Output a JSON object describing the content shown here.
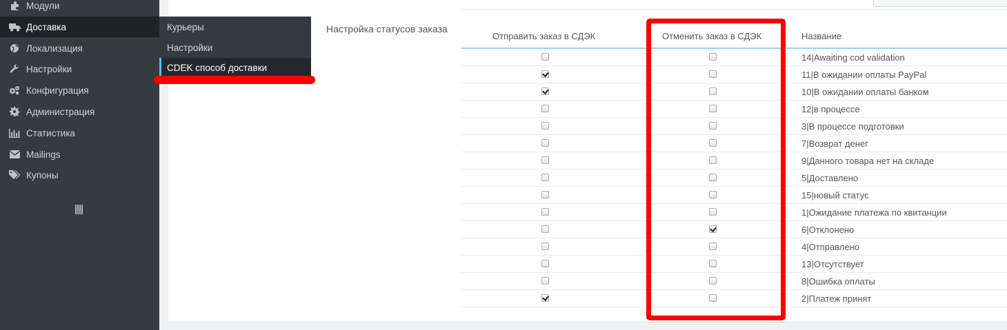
{
  "sidebar": {
    "items": [
      {
        "label": "Модули",
        "icon": "puzzle-icon"
      },
      {
        "label": "Доставка",
        "icon": "truck-icon",
        "active": true
      },
      {
        "label": "Локализация",
        "icon": "globe-icon"
      },
      {
        "label": "Настройки",
        "icon": "wrench-icon"
      },
      {
        "label": "Конфигурация",
        "icon": "cogs-icon"
      },
      {
        "label": "Администрация",
        "icon": "gear-icon"
      },
      {
        "label": "Статистика",
        "icon": "bar-chart-icon"
      },
      {
        "label": "Mailings",
        "icon": "envelope-icon"
      },
      {
        "label": "Купоны",
        "icon": "tags-icon"
      }
    ],
    "collapse_icon": "collapse-bars-icon"
  },
  "submenu": {
    "items": [
      {
        "label": "Курьеры"
      },
      {
        "label": "Настройки"
      },
      {
        "label": "CDEK способ доставки",
        "selected": true
      }
    ]
  },
  "form": {
    "section_label": "Настройка статусов заказа",
    "columns": {
      "send": "Отправить заказ в СДЭК",
      "cancel": "Отменить заказ в СДЭК",
      "name": "Название"
    },
    "rows": [
      {
        "name": "14|Awaiting cod validation",
        "send": false,
        "cancel": false
      },
      {
        "name": "11|В ожидании оплаты PayPal",
        "send": true,
        "cancel": false
      },
      {
        "name": "10|В ожидании оплаты банком",
        "send": true,
        "cancel": false
      },
      {
        "name": "12|в процессе",
        "send": false,
        "cancel": false
      },
      {
        "name": "3|В процессе подготовки",
        "send": false,
        "cancel": false
      },
      {
        "name": "7|Возврат денег",
        "send": false,
        "cancel": false
      },
      {
        "name": "9|Данного товара нет на складе",
        "send": false,
        "cancel": false
      },
      {
        "name": "5|Доставлено",
        "send": false,
        "cancel": false
      },
      {
        "name": "15|новый статус",
        "send": false,
        "cancel": false
      },
      {
        "name": "1|Ожидание платежа по квитанции",
        "send": false,
        "cancel": false
      },
      {
        "name": "6|Отклонено",
        "send": false,
        "cancel": true
      },
      {
        "name": "4|Отправлено",
        "send": false,
        "cancel": false
      },
      {
        "name": "13|Отсутствует",
        "send": false,
        "cancel": false
      },
      {
        "name": "8|Ошибка оплаты",
        "send": false,
        "cancel": false
      },
      {
        "name": "2|Платеж принят",
        "send": true,
        "cancel": false
      }
    ]
  },
  "colors": {
    "sidebar_bg": "#363a41",
    "active_bg": "#202226",
    "accent": "#5cc1e6",
    "annotation_red": "#ff0000"
  }
}
